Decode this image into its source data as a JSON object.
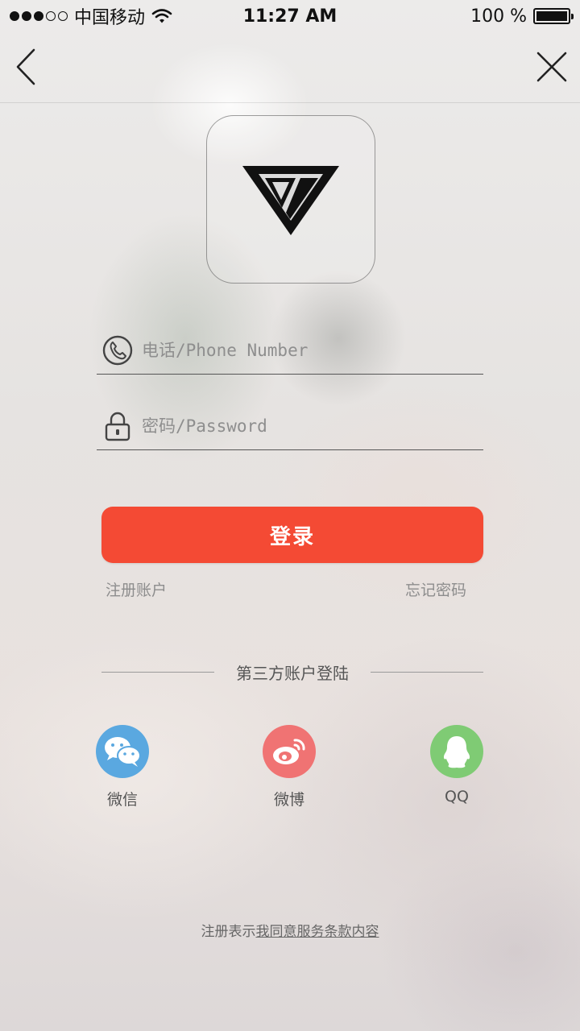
{
  "status_bar": {
    "carrier": "中国移动",
    "time": "11:27 AM",
    "battery": "100 %",
    "battery_level": 1.0,
    "signal_bars_filled": 3,
    "signal_bars_total": 5
  },
  "nav": {
    "back_icon": "chevron-left-icon",
    "close_icon": "close-icon"
  },
  "logo": {
    "icon": "triangle-logo-icon"
  },
  "form": {
    "phone_placeholder": "电话/Phone Number",
    "phone_icon": "phone-icon",
    "password_placeholder": "密码/Password",
    "password_icon": "lock-icon"
  },
  "actions": {
    "login_label": "登录",
    "register_label": "注册账户",
    "forgot_label": "忘记密码"
  },
  "third_party": {
    "title": "第三方账户登陆",
    "providers": [
      {
        "label": "微信",
        "icon": "wechat-icon",
        "color": "#5aa8e0"
      },
      {
        "label": "微博",
        "icon": "weibo-icon",
        "color": "#f07373"
      },
      {
        "label": "QQ",
        "icon": "qq-icon",
        "color": "#7fcb74"
      }
    ]
  },
  "terms": {
    "prefix": "注册表示",
    "link": "我同意服务条款内容"
  },
  "colors": {
    "accent": "#f44a34"
  }
}
